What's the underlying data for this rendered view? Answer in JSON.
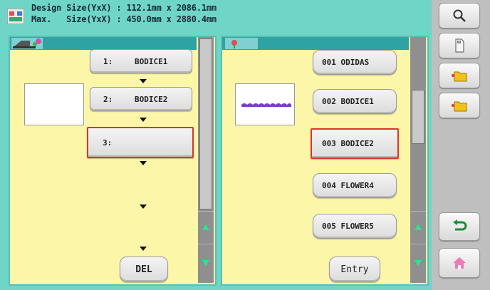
{
  "header": {
    "line1": "Design Size(YxX) : 112.1mm x 2086.1mm",
    "line2": "Max.   Size(YxX) : 450.0mm x 2880.4mm"
  },
  "left_panel": {
    "slots": [
      {
        "number": "1:",
        "name": "BODICE1"
      },
      {
        "number": "2:",
        "name": "BODICE2"
      },
      {
        "number": "3:",
        "name": ""
      }
    ],
    "selected_slot": 3,
    "del_label": "DEL"
  },
  "right_panel": {
    "items": [
      {
        "label": "001 ODIDAS"
      },
      {
        "label": "002 BODICE1"
      },
      {
        "label": "003 BODICE2"
      },
      {
        "label": "004 FLOWER4"
      },
      {
        "label": "005 FLOWER5"
      }
    ],
    "selected_item": 3,
    "entry_label": "Entry"
  },
  "toolbar": {
    "icons": [
      "zoom-icon",
      "memory-card-icon",
      "folder-up-icon",
      "folder-next-icon",
      "return-icon",
      "home-icon"
    ]
  },
  "colors": {
    "background": "#6fd6c7",
    "panel": "#fcf6a9",
    "selection_border": "#e0332b",
    "toolbar": "#bfbfbf",
    "scroll_arrow": "#2fe38a"
  }
}
